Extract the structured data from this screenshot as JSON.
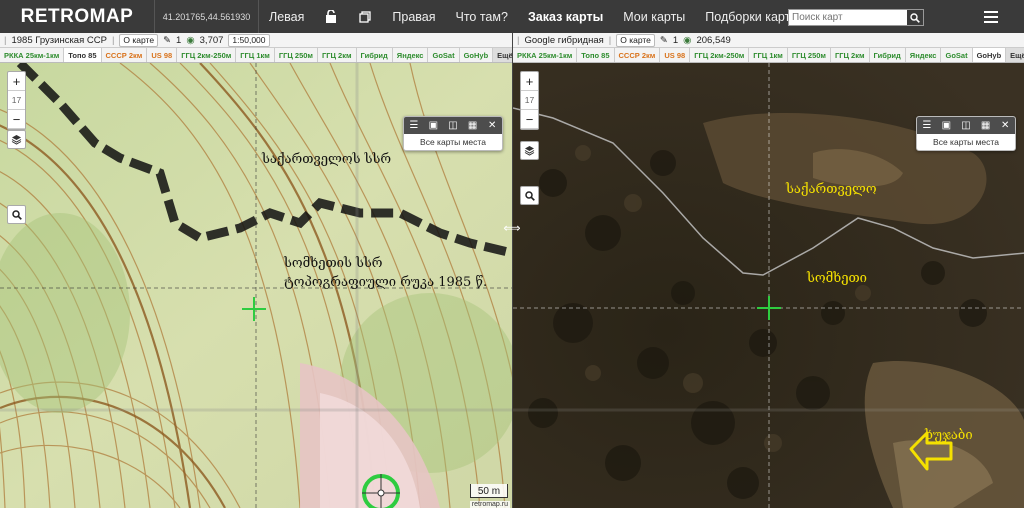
{
  "header": {
    "logo": "RETROMAP",
    "coords": "41.201765,44.561930",
    "nav": {
      "left": "Левая",
      "right": "Правая",
      "what": "Что там?",
      "order": "Заказ карты",
      "mymaps": "Мои карты",
      "collections": "Подборки карт"
    },
    "search_placeholder": "Поиск карт"
  },
  "left_pane": {
    "map_title": "1985 Грузинская ССР",
    "on_map": "О карте",
    "edits": "1",
    "views": "3,707",
    "scale_ratio": "1:50,000",
    "tabs": [
      "РККА 25км-1км",
      "Топо 85",
      "СССР 2км",
      "US 98",
      "ГГЦ 2км-250м",
      "ГГЦ 1км",
      "ГГЦ 250м",
      "ГГЦ 2км",
      "Гибрид",
      "Яндекс",
      "GoSat",
      "GoHyb",
      "Ещё..."
    ],
    "active_tab": "Топо 85",
    "zoom_level": "17",
    "places_label": "Все карты места",
    "labels": {
      "l1": "საქართველოს სსრ",
      "l2": "სომხეთის სსრ",
      "l3": "ტოპოგრაფიული რუკა 1985 წ."
    },
    "scale_text": "50 m",
    "credit": "retromap.ru"
  },
  "right_pane": {
    "map_title": "Google гибридная",
    "on_map": "О карте",
    "edits": "1",
    "views": "206,549",
    "tabs": [
      "РККА 25км-1км",
      "Топо 85",
      "СССР 2км",
      "US 98",
      "ГГЦ 2км-250м",
      "ГГЦ 1км",
      "ГГЦ 250м",
      "ГГЦ 2км",
      "Гибрид",
      "Яндекс",
      "GoSat",
      "GoHyb",
      "Ещё..."
    ],
    "active_tab": "GoHyb",
    "zoom_level": "17",
    "places_label": "Все карты места",
    "labels": {
      "l1": "საქართველო",
      "l2": "სომხეთი",
      "l3": "ხუჯაბი"
    }
  },
  "icons": {
    "lock": "lock-icon",
    "copy": "copy-icon",
    "search": "search-icon",
    "menu": "hamburger-icon",
    "layers": "layers-icon",
    "swap": "swap-arrows-icon"
  },
  "colors": {
    "topbar": "#3a3a3a",
    "tab_green": "#2f8d2f",
    "tab_orange": "#d9731c",
    "crosshair": "#2ecc40",
    "label_yellow": "#f5e100"
  }
}
